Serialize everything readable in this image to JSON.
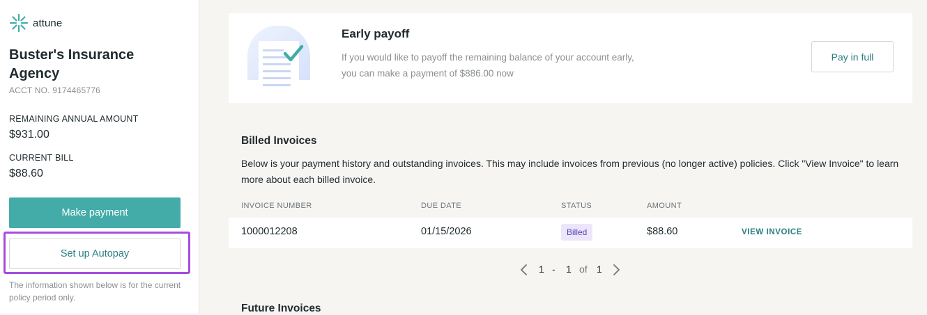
{
  "brand": {
    "name": "attune",
    "logo_icon": "sunburst-logo-icon",
    "accent": "#43aca9"
  },
  "account": {
    "agency_name": "Buster's Insurance Agency",
    "acct_label": "ACCT NO. 9174465776",
    "remaining_label": "REMAINING ANNUAL AMOUNT",
    "remaining_value": "$931.00",
    "current_bill_label": "CURRENT BILL",
    "current_bill_value": "$88.60"
  },
  "actions": {
    "make_payment": "Make payment",
    "setup_autopay": "Set up Autopay",
    "note": "The information shown below is for the current policy period only."
  },
  "early_payoff": {
    "title": "Early payoff",
    "description": "If you would like to payoff the remaining balance of your account early, you can make a payment of $886.00 now",
    "button": "Pay in full",
    "illustration_icon": "document-check-icon"
  },
  "billed_invoices": {
    "title": "Billed Invoices",
    "description": "Below is your payment history and outstanding invoices. This may include invoices from previous (no longer active) policies. Click \"View Invoice\" to learn more about each billed invoice.",
    "columns": [
      "INVOICE NUMBER",
      "DUE DATE",
      "STATUS",
      "AMOUNT"
    ],
    "rows": [
      {
        "invoice_number": "1000012208",
        "due_date": "01/15/2026",
        "status": "Billed",
        "amount": "$88.60",
        "action": "VIEW INVOICE"
      }
    ],
    "pagination": {
      "from": "1",
      "dash": "-",
      "to": "1",
      "of": "of",
      "total": "1"
    }
  },
  "future_invoices": {
    "title": "Future Invoices"
  },
  "colors": {
    "highlight": "#a44de0",
    "badge_bg": "#ece6fb",
    "badge_text": "#5a3fb0",
    "link": "#2a7f83"
  }
}
